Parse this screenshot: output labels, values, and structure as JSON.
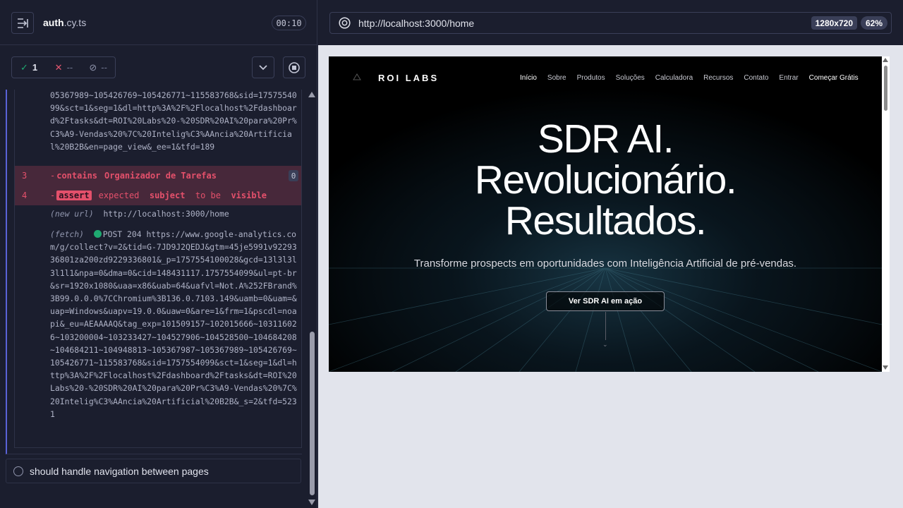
{
  "reporter": {
    "spec_file_base": "auth",
    "spec_file_ext": ".cy.ts",
    "timer": "00:10",
    "stats": {
      "passed": "1",
      "failed": "--",
      "pending": "--"
    },
    "log": {
      "url_block_1": "05367989~105426769~105426771~115583768&sid=1757554099&sct=1&seg=1&dl=http%3A%2F%2Flocalhost%2Fdashboard%2Ftasks&dt=ROI%20Labs%20-%20SDR%20AI%20para%20Pr%C3%A9-Vendas%20%7C%20Intelig%C3%AAncia%20Artificial%20B2B&en=page_view&_ee=1&tfd=189",
      "commands": [
        {
          "num": "3",
          "name": "contains",
          "message": "Organizador de Tarefas",
          "badge": "0"
        },
        {
          "num": "4",
          "name": "assert",
          "msg_expected": "expected",
          "msg_subject": "subject",
          "msg_to_be": "to be",
          "msg_visible": "visible"
        }
      ],
      "new_url_label": "(new url)",
      "new_url_value": "http://localhost:3000/home",
      "fetch_label": "(fetch)",
      "fetch_value": "POST 204 https://www.google-analytics.com/g/collect?v=2&tid=G-7JD9J2QEDJ&gtm=45je5991v9229336801za200zd9229336801&_p=1757554100028&gcd=13l3l3l3l1l1&npa=0&dma=0&cid=148431117.1757554099&ul=pt-br&sr=1920x1080&uaa=x86&uab=64&uafvl=Not.A%252FBrand%3B99.0.0.0%7CChromium%3B136.0.7103.149&uamb=0&uam=&uap=Windows&uapv=19.0.0&uaw=0&are=1&frm=1&pscdl=noapi&_eu=AEAAAAQ&tag_exp=101509157~102015666~103116026~103200004~103233427~104527906~104528500~104684208~104684211~104948813~105367987~105367989~105426769~105426771~115583768&sid=1757554099&sct=1&seg=1&dl=http%3A%2F%2Flocalhost%2Fdashboard%2Ftasks&dt=ROI%20Labs%20-%20SDR%20AI%20para%20Pr%C3%A9-Vendas%20%7C%20Intelig%C3%AAncia%20Artificial%20B2B&_s=2&tfd=5231"
    },
    "pending_test": "should handle navigation between pages"
  },
  "aut": {
    "url": "http://localhost:3000/home",
    "viewport": "1280x720",
    "zoom": "62%"
  },
  "site": {
    "logo": "ROI LABS",
    "nav": [
      "Início",
      "Sobre",
      "Produtos",
      "Soluções",
      "Calculadora",
      "Recursos",
      "Contato",
      "Entrar"
    ],
    "cta": "Começar Grátis",
    "hero_line1": "SDR AI.",
    "hero_line2": "Revolucionário.",
    "hero_line3": "Resultados.",
    "hero_subtitle": "Transforme prospects em oportunidades com Inteligência Artificial de pré-vendas.",
    "hero_button": "Ver SDR AI em ação"
  },
  "colors": {
    "pass": "#1fa971",
    "fail": "#e4506b",
    "accent": "#5a62d6"
  },
  "icons": [
    "collapse-icon",
    "check-icon",
    "x-icon",
    "pending-icon",
    "chevron-down-icon",
    "stop-icon",
    "globe-icon",
    "logo-icon"
  ]
}
